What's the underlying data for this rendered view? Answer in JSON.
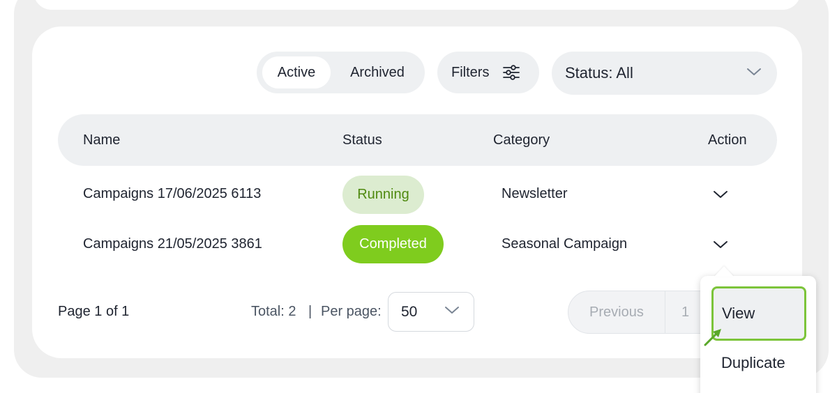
{
  "toolbar": {
    "tab_active": "Active",
    "tab_archived": "Archived",
    "filters_label": "Filters",
    "status_select_value": "Status: All"
  },
  "table": {
    "columns": [
      "Name",
      "Status",
      "Category",
      "Action"
    ],
    "rows": [
      {
        "name": "Campaigns 17/06/2025 6113",
        "status": "Running",
        "category": "Newsletter"
      },
      {
        "name": "Campaigns 21/05/2025 3861",
        "status": "Completed",
        "category": "Seasonal Campaign"
      }
    ]
  },
  "pagination": {
    "page_info": "Page 1 of 1",
    "total": "Total: 2",
    "separator": "|",
    "per_page_label": "Per page:",
    "per_page_value": "50",
    "previous_label": "Previous",
    "current_page": "1"
  },
  "action_menu": {
    "items": [
      "View",
      "Duplicate"
    ],
    "highlighted_item": "View"
  },
  "colors": {
    "running_bg": "#dcecd0",
    "running_text": "#4f8a10",
    "completed_bg": "#7fcc1e",
    "highlight_border": "#7cc43a"
  }
}
